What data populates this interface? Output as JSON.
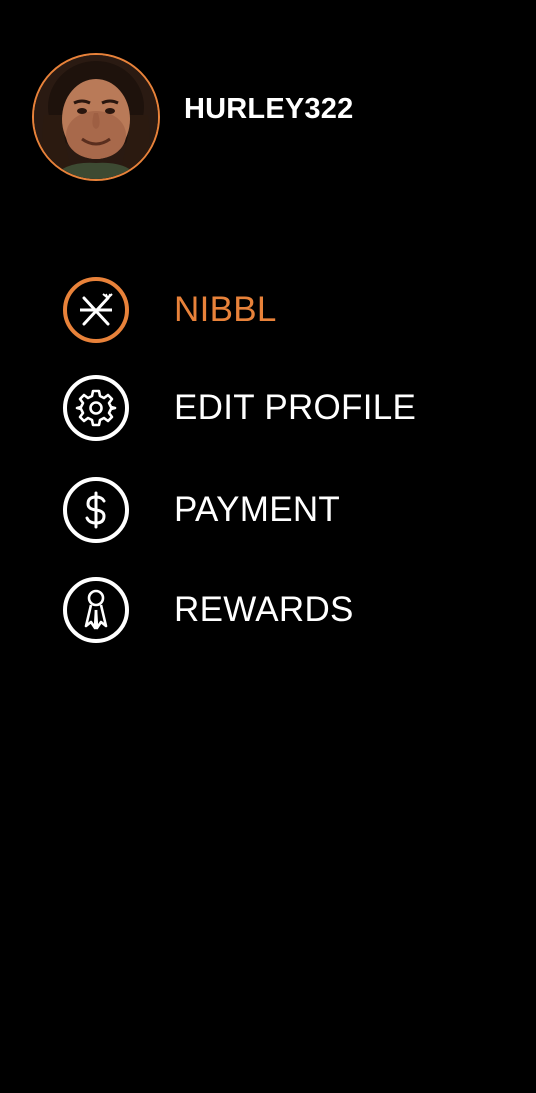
{
  "user": {
    "username": "HURLEY322",
    "avatar": "profile-photo"
  },
  "colors": {
    "background": "#000000",
    "accent": "#e8823a",
    "text": "#ffffff"
  },
  "menu": {
    "active_index": 0,
    "items": [
      {
        "label": "NIBBL",
        "icon": "fork-knife-icon",
        "active": true
      },
      {
        "label": "EDIT PROFILE",
        "icon": "gear-icon",
        "active": false
      },
      {
        "label": "PAYMENT",
        "icon": "dollar-icon",
        "active": false
      },
      {
        "label": "REWARDS",
        "icon": "award-ribbon-icon",
        "active": false
      }
    ]
  }
}
